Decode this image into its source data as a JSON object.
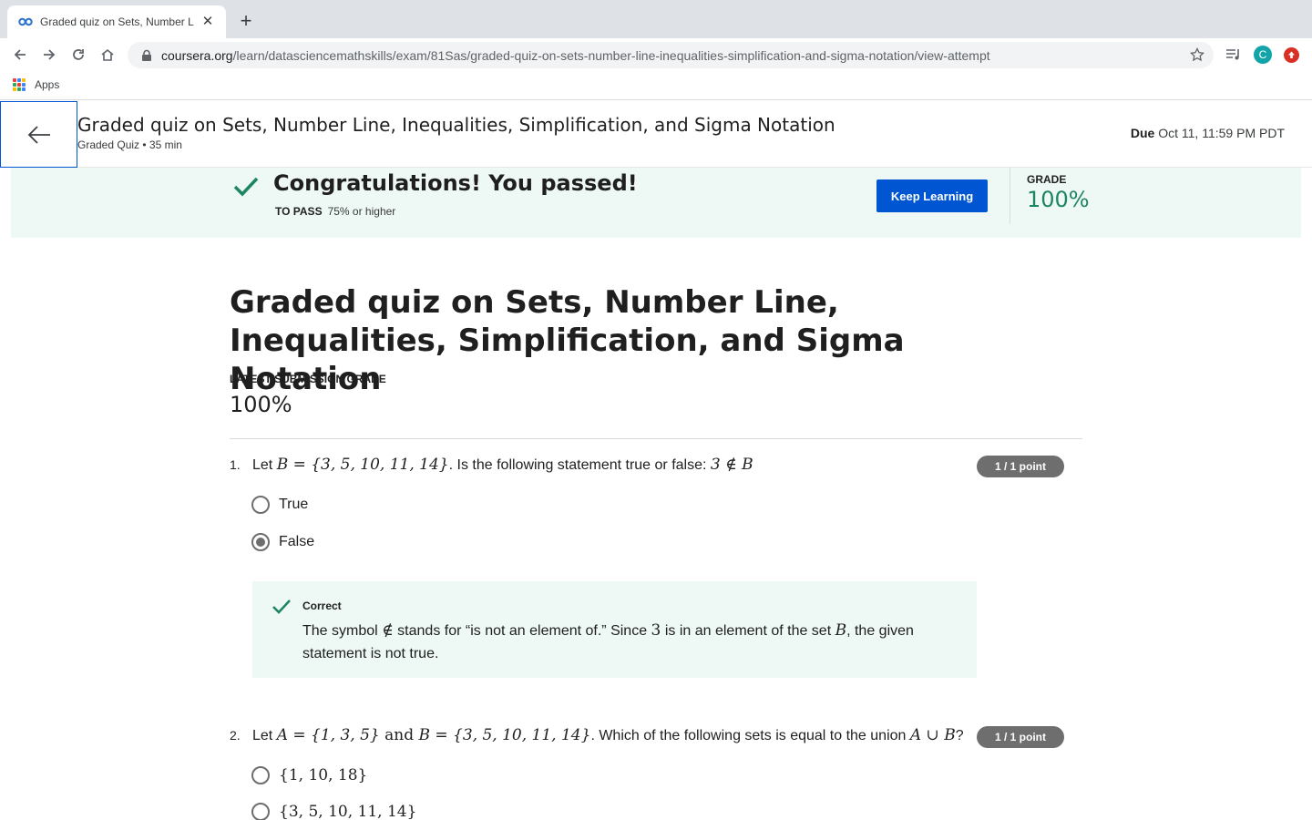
{
  "browser": {
    "tab_title": "Graded quiz on Sets, Number Line, Inequalities, Simplification, and Sigma Notation | Coursera",
    "tab_title_short": "Graded quiz on Sets, Number L",
    "url_host": "coursera.org",
    "url_path": "/learn/datasciencemathskills/exam/81Sas/graded-quiz-on-sets-number-line-inequalities-simplification-and-sigma-notation/view-attempt",
    "profile_initial": "C",
    "bookmarks_apps_label": "Apps"
  },
  "header": {
    "title": "Graded quiz on Sets, Number Line, Inequalities, Simplification, and Sigma Notation",
    "subtitle": "Graded Quiz • 35 min",
    "due_label": "Due",
    "due_value": "Oct 11, 11:59 PM PDT"
  },
  "banner": {
    "message": "Congratulations! You passed!",
    "to_pass_label": "TO PASS",
    "to_pass_value": "75% or higher",
    "keep_learning_label": "Keep Learning",
    "grade_label": "GRADE",
    "grade_value": "100%"
  },
  "quiz": {
    "title": "Graded quiz on Sets, Number Line, Inequalities, Simplification, and Sigma Notation",
    "latest_grade_label": "LATEST SUBMISSION GRADE",
    "latest_grade_value": "100%",
    "questions": [
      {
        "number": "1.",
        "points": "1 / 1 point",
        "text_pre": "Let ",
        "math_1": "B = {3, 5, 10, 11, 14}",
        "text_mid": ". Is the following statement true or false: ",
        "math_2": "3 ∉ B",
        "options": [
          {
            "label": "True",
            "selected": false
          },
          {
            "label": "False",
            "selected": true
          }
        ],
        "feedback": {
          "title": "Correct",
          "text_a": "The symbol ",
          "math_a": "∉",
          "text_b": " stands for “is not an element of.” Since ",
          "math_b": "3",
          "text_c": " is in an element of the set ",
          "math_c": "B",
          "text_d": ", the given statement is not true."
        }
      },
      {
        "number": "2.",
        "points": "1 / 1 point",
        "text_pre": "Let ",
        "math_1": "A = {1, 3, 5}",
        "math_and": " and ",
        "math_2": "B = {3, 5, 10, 11, 14}",
        "text_mid": ". Which of the following sets is equal to the union ",
        "math_3": "A ∪ B",
        "text_end": "?",
        "options": [
          {
            "label": "{1, 10, 18}",
            "selected": false
          },
          {
            "label": "{3, 5, 10, 11, 14}",
            "selected": false
          }
        ]
      }
    ]
  },
  "colors": {
    "primary_blue": "#0056d2",
    "success_green": "#1e8564",
    "success_bg": "#eef8f5",
    "points_pill": "#6e6e6e"
  },
  "icons": {
    "tab_favicon": "coursera-logo-icon",
    "back": "arrow-left-icon",
    "passed": "checkmark-icon",
    "correct": "checkmark-icon"
  }
}
